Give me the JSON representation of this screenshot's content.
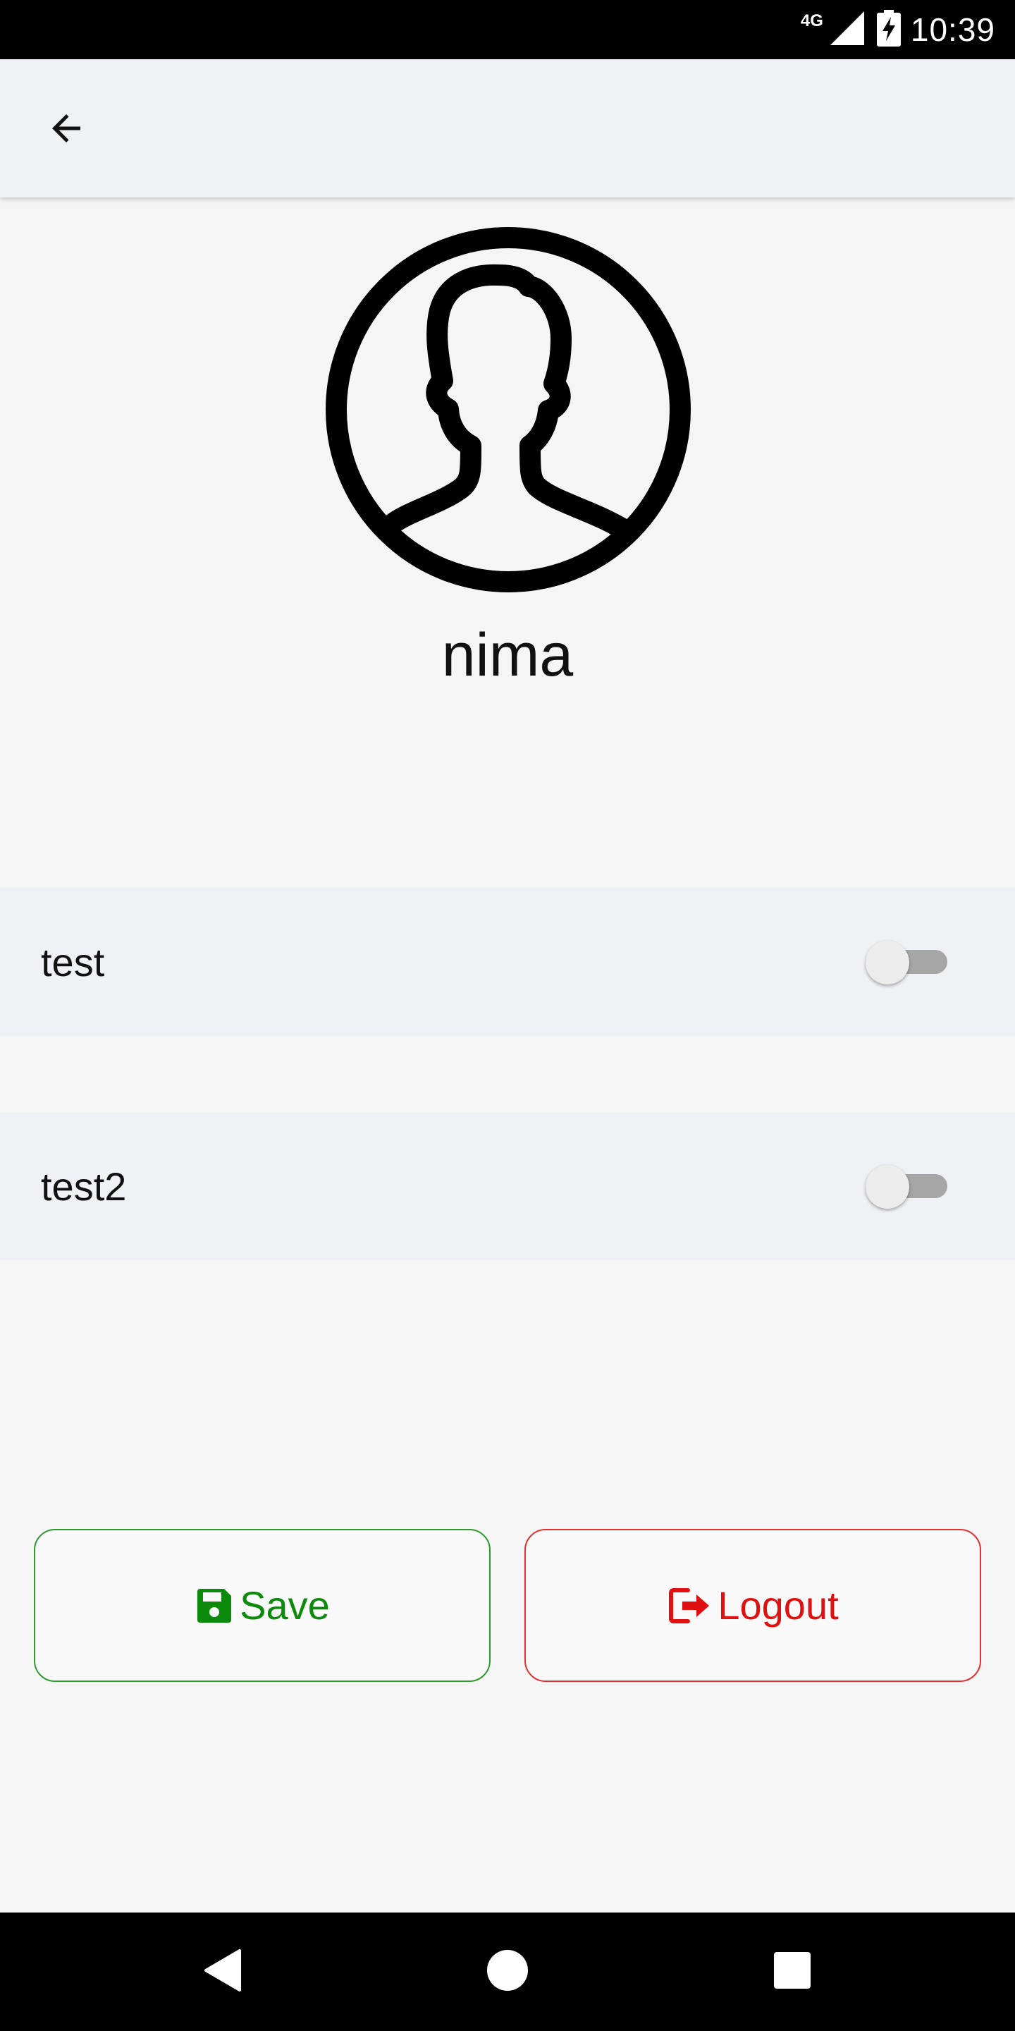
{
  "status_bar": {
    "network": "4G",
    "time": "10:39",
    "icons": [
      "signal-icon",
      "battery-charging-icon"
    ]
  },
  "app_bar": {
    "back_icon": "arrow-left-icon"
  },
  "profile": {
    "avatar_icon": "user-circle-icon",
    "username": "nima"
  },
  "settings": [
    {
      "label": "test",
      "enabled": false
    },
    {
      "label": "test2",
      "enabled": false
    }
  ],
  "actions": {
    "save": {
      "label": "Save",
      "icon": "floppy-disk-icon",
      "color": "#0c8a0c"
    },
    "logout": {
      "label": "Logout",
      "icon": "sign-out-icon",
      "color": "#e01010"
    }
  },
  "nav_bar": {
    "icons": [
      "nav-back-icon",
      "nav-home-icon",
      "nav-recents-icon"
    ]
  }
}
